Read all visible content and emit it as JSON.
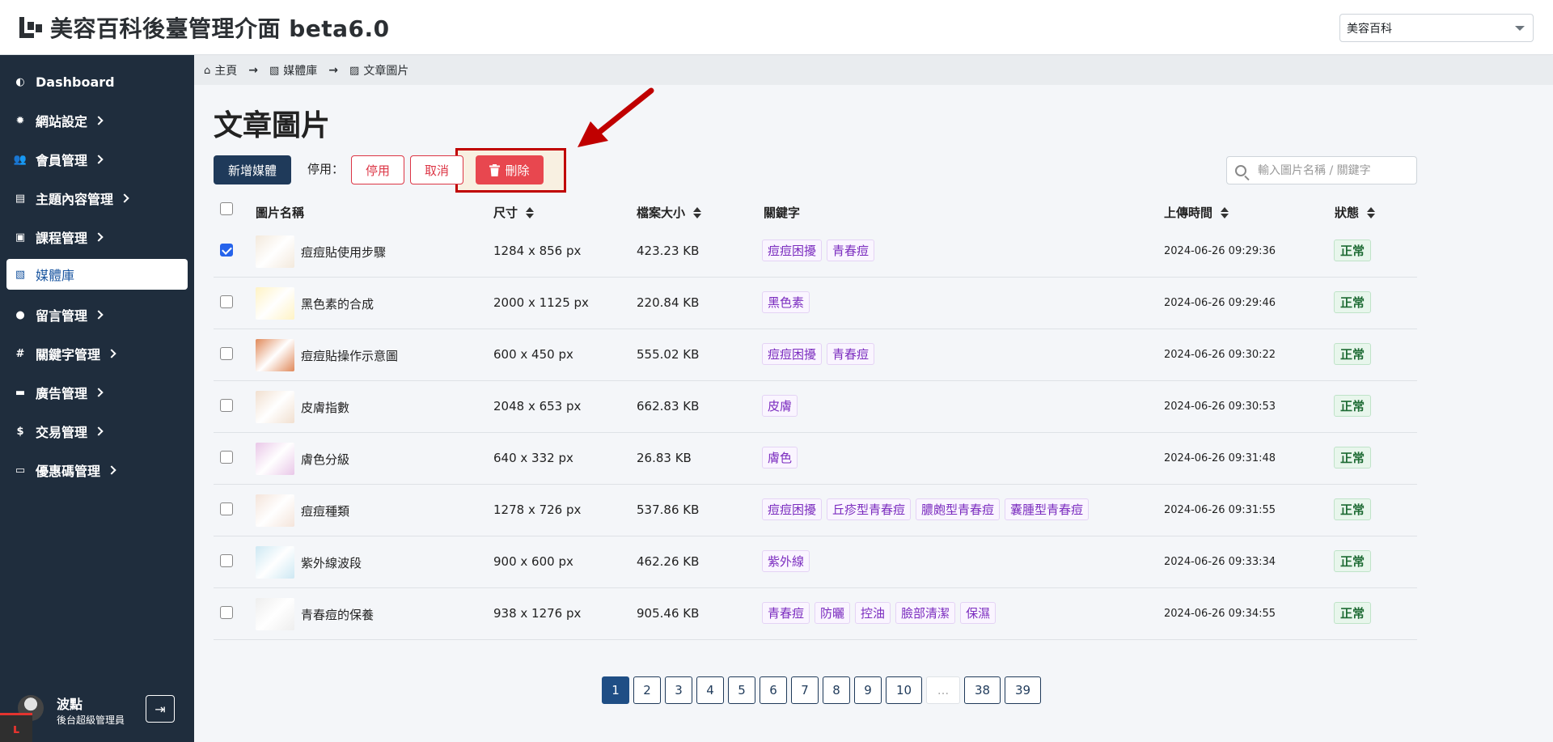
{
  "header": {
    "title": "美容百科後臺管理介面 beta6.0",
    "site_select": "美容百科"
  },
  "sidebar": {
    "items": [
      {
        "label": "Dashboard",
        "icon": "palette-icon",
        "glyph": "◐"
      },
      {
        "label": "網站設定",
        "icon": "gear-icon",
        "glyph": "✹"
      },
      {
        "label": "會員管理",
        "icon": "users-icon",
        "glyph": "👥"
      },
      {
        "label": "主題內容管理",
        "icon": "book-open-icon",
        "glyph": "▤"
      },
      {
        "label": "課程管理",
        "icon": "book-icon",
        "glyph": "▣"
      },
      {
        "label": "媒體庫",
        "icon": "images-icon",
        "glyph": "▧"
      },
      {
        "label": "留言管理",
        "icon": "comment-icon",
        "glyph": "●"
      },
      {
        "label": "關鍵字管理",
        "icon": "hashtag-icon",
        "glyph": "#"
      },
      {
        "label": "廣告管理",
        "icon": "ad-icon",
        "glyph": "▬"
      },
      {
        "label": "交易管理",
        "icon": "money-bag-icon",
        "glyph": "$"
      },
      {
        "label": "優惠碼管理",
        "icon": "ticket-icon",
        "glyph": "▭"
      }
    ],
    "user": {
      "name": "波點",
      "role": "後台超級管理員"
    }
  },
  "breadcrumb": [
    {
      "label": "主頁",
      "glyph": "⌂"
    },
    {
      "label": "媒體庫",
      "glyph": "▧"
    },
    {
      "label": "文章圖片",
      "glyph": "▨"
    }
  ],
  "page": {
    "title": "文章圖片",
    "add_button": "新增媒體",
    "disable_label": "停用：",
    "disable_button": "停用",
    "cancel_button": "取消",
    "delete_button": "刪除",
    "search_placeholder": "輸入圖片名稱 / 關鍵字"
  },
  "table": {
    "headers": {
      "name": "圖片名稱",
      "size": "尺寸",
      "filesize": "檔案大小",
      "keywords": "關鍵字",
      "uploaded": "上傳時間",
      "status": "狀態"
    },
    "rows": [
      {
        "checked": true,
        "name": "痘痘貼使用步驟",
        "size": "1284 x 856 px",
        "filesize": "423.23 KB",
        "keywords": [
          "痘痘困擾",
          "青春痘"
        ],
        "uploaded": "2024-06-26 09:29:36",
        "status": "正常",
        "thumb": "#f3e9dc"
      },
      {
        "checked": false,
        "name": "黑色素的合成",
        "size": "2000 x 1125 px",
        "filesize": "220.84 KB",
        "keywords": [
          "黑色素"
        ],
        "uploaded": "2024-06-26 09:29:46",
        "status": "正常",
        "thumb": "#fff3c4"
      },
      {
        "checked": false,
        "name": "痘痘貼操作示意圖",
        "size": "600 x 450 px",
        "filesize": "555.02 KB",
        "keywords": [
          "痘痘困擾",
          "青春痘"
        ],
        "uploaded": "2024-06-26 09:30:22",
        "status": "正常",
        "thumb": "#e0895a"
      },
      {
        "checked": false,
        "name": "皮膚指數",
        "size": "2048 x 653 px",
        "filesize": "662.83 KB",
        "keywords": [
          "皮膚"
        ],
        "uploaded": "2024-06-26 09:30:53",
        "status": "正常",
        "thumb": "#f1dfcf"
      },
      {
        "checked": false,
        "name": "膚色分級",
        "size": "640 x 332 px",
        "filesize": "26.83 KB",
        "keywords": [
          "膚色"
        ],
        "uploaded": "2024-06-26 09:31:48",
        "status": "正常",
        "thumb": "#e9c7e8"
      },
      {
        "checked": false,
        "name": "痘痘種類",
        "size": "1278 x 726 px",
        "filesize": "537.86 KB",
        "keywords": [
          "痘痘困擾",
          "丘疹型青春痘",
          "膿皰型青春痘",
          "囊腫型青春痘"
        ],
        "uploaded": "2024-06-26 09:31:55",
        "status": "正常",
        "thumb": "#f4e4da"
      },
      {
        "checked": false,
        "name": "紫外線波段",
        "size": "900 x 600 px",
        "filesize": "462.26 KB",
        "keywords": [
          "紫外線"
        ],
        "uploaded": "2024-06-26 09:33:34",
        "status": "正常",
        "thumb": "#cde8f3"
      },
      {
        "checked": false,
        "name": "青春痘的保養",
        "size": "938 x 1276 px",
        "filesize": "905.46 KB",
        "keywords": [
          "青春痘",
          "防曬",
          "控油",
          "臉部清潔",
          "保濕"
        ],
        "uploaded": "2024-06-26 09:34:55",
        "status": "正常",
        "thumb": "#eeeeee"
      }
    ]
  },
  "pagination": {
    "pages": [
      "1",
      "2",
      "3",
      "4",
      "5",
      "6",
      "7",
      "8",
      "9",
      "10",
      "...",
      "38",
      "39"
    ],
    "current": "1"
  },
  "colors": {
    "sidebar": "#1f2d3d",
    "primary": "#1f3a5a",
    "danger": "#e8474f",
    "highlight": "#c00000",
    "tag": "#7b2cbf"
  }
}
